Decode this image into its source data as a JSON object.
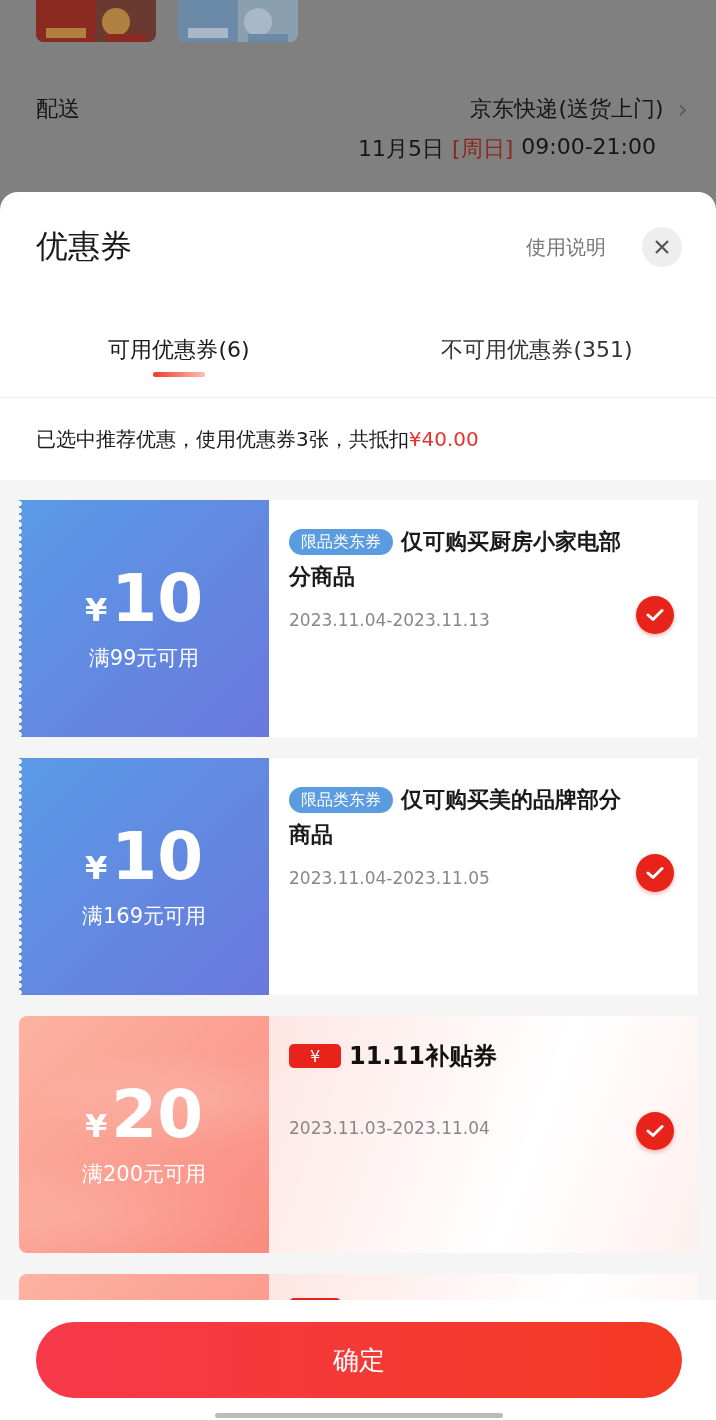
{
  "background_page": {
    "delivery": {
      "label": "配送",
      "method": "京东快递(送货上门)",
      "chevron": "›",
      "date": "11月5日",
      "weekday": "[周日]",
      "time": "09:00-21:00"
    }
  },
  "sheet": {
    "title": "优惠券",
    "help_link": "使用说明",
    "tabs": [
      {
        "label": "可用优惠券(6)",
        "selected": true
      },
      {
        "label": "不可用优惠券(351)",
        "selected": false
      }
    ],
    "summary": "已选中推荐优惠，使用优惠券3张，共抵扣",
    "summary_amount": "¥40.00",
    "coupons": [
      {
        "kind": "category",
        "currency": "¥",
        "amount": "10",
        "condition": "满99元可用",
        "tag": "限品类东券",
        "title": "仅可购买厨房小家电部分商品",
        "validity": "2023.11.04-2023.11.13",
        "selected": true
      },
      {
        "kind": "category",
        "currency": "¥",
        "amount": "10",
        "condition": "满169元可用",
        "tag": "限品类东券",
        "title": "仅可购买美的品牌部分商品",
        "validity": "2023.11.04-2023.11.05",
        "selected": true
      },
      {
        "kind": "subsidy",
        "currency": "¥",
        "amount": "20",
        "condition": "满200元可用",
        "badge": "¥",
        "title": "11.11补贴券",
        "validity": "2023.11.03-2023.11.04",
        "selected": true
      },
      {
        "kind": "subsidy"
      }
    ],
    "confirm_button": "确定"
  }
}
